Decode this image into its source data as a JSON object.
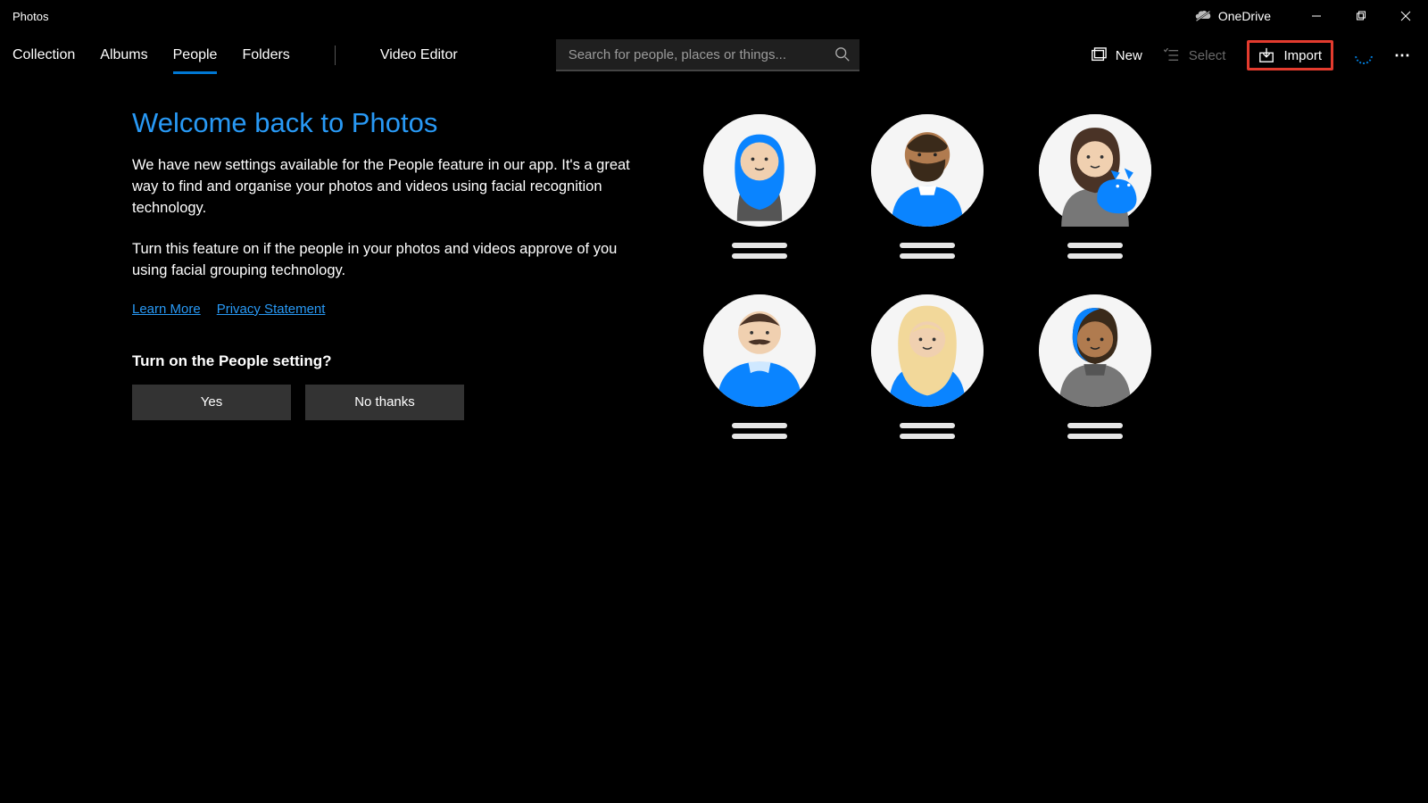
{
  "app": {
    "title": "Photos"
  },
  "titlebar": {
    "onedrive": "OneDrive"
  },
  "nav": {
    "tabs": [
      "Collection",
      "Albums",
      "People",
      "Folders"
    ],
    "extra": "Video Editor",
    "active": "People"
  },
  "search": {
    "placeholder": "Search for people, places or things..."
  },
  "toolbar": {
    "new": "New",
    "select": "Select",
    "import": "Import"
  },
  "content": {
    "title": "Welcome back to Photos",
    "p1": "We have new settings available for the People feature in our app. It's a great way to find and organise your photos and videos using facial recognition technology.",
    "p2": "Turn this feature on if the people in your photos and videos approve of you using facial grouping technology.",
    "learn_more": "Learn More",
    "privacy": "Privacy Statement",
    "question": "Turn on the People setting?",
    "yes": "Yes",
    "no": "No thanks"
  },
  "avatars": [
    {
      "id": "woman-hijab"
    },
    {
      "id": "man-beard"
    },
    {
      "id": "woman-cat"
    },
    {
      "id": "man-mustache"
    },
    {
      "id": "woman-blonde"
    },
    {
      "id": "woman-blue-hair"
    }
  ],
  "colors": {
    "accent": "#0078d4",
    "link": "#2899f5",
    "highlight_border": "#e33b2e"
  }
}
